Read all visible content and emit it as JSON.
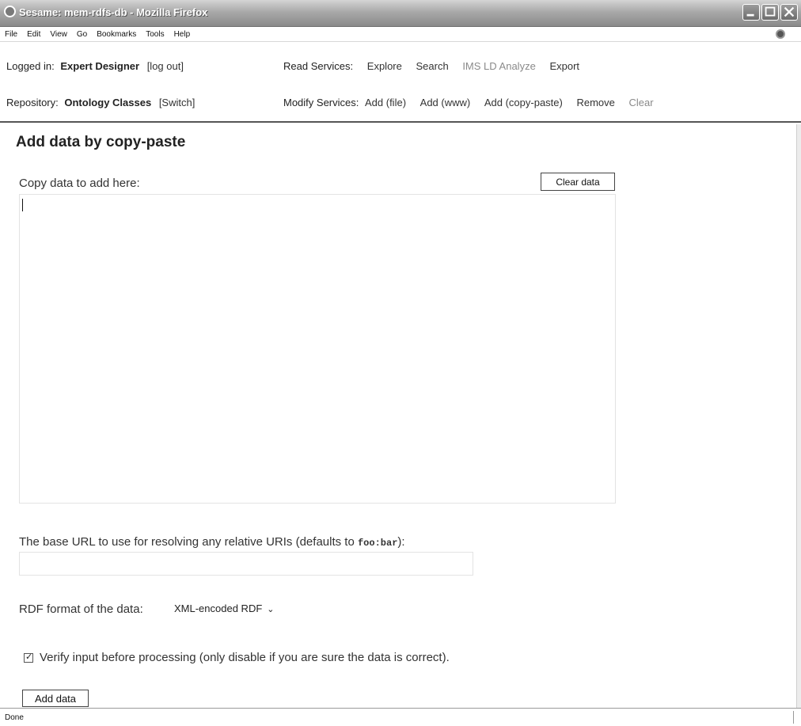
{
  "window": {
    "title": "Sesame: mem-rdfs-db - Mozilla Firefox"
  },
  "menubar": {
    "items": [
      "File",
      "Edit",
      "View",
      "Go",
      "Bookmarks",
      "Tools",
      "Help"
    ]
  },
  "header": {
    "logged_in_label": "Logged in:",
    "user_name": "Expert Designer",
    "logout_link": "[log out]",
    "repository_label": "Repository:",
    "repository_name": "Ontology Classes",
    "switch_link": "[Switch]",
    "read_services_label": "Read Services:",
    "read_services": [
      "Explore",
      "Search",
      "IMS LD Analyze",
      "Export"
    ],
    "modify_services_label": "Modify Services:",
    "modify_services": [
      "Add (file)",
      "Add (www)",
      "Add (copy-paste)",
      "Remove",
      "Clear"
    ]
  },
  "form": {
    "page_title": "Add data by copy-paste",
    "copy_label": "Copy data to add here:",
    "clear_data_label": "Clear data",
    "textarea_value": "",
    "base_url_label_prefix": "The base URL to use for resolving any relative URIs (defaults to ",
    "base_url_default_code": "foo:bar",
    "base_url_label_suffix": "):",
    "base_url_value": "",
    "format_label": "RDF format of the data:",
    "format_selected": "XML-encoded RDF",
    "verify_label": "Verify input before processing (only disable if you are sure the data is correct).",
    "verify_checked": true,
    "add_data_label": "Add data"
  },
  "statusbar": {
    "text": "Done"
  },
  "icons": {
    "app": "firefox-icon",
    "minimize": "minimize-icon",
    "maximize": "maximize-icon",
    "close": "close-icon",
    "throbber": "throbber-icon",
    "dropdown": "chevron-down-icon",
    "checkbox": "checkbox-checked-icon"
  },
  "colors": {
    "titlebar": "#8a8a8a",
    "page_background": "#ffffff",
    "link_muted": "#8a8a8a"
  }
}
